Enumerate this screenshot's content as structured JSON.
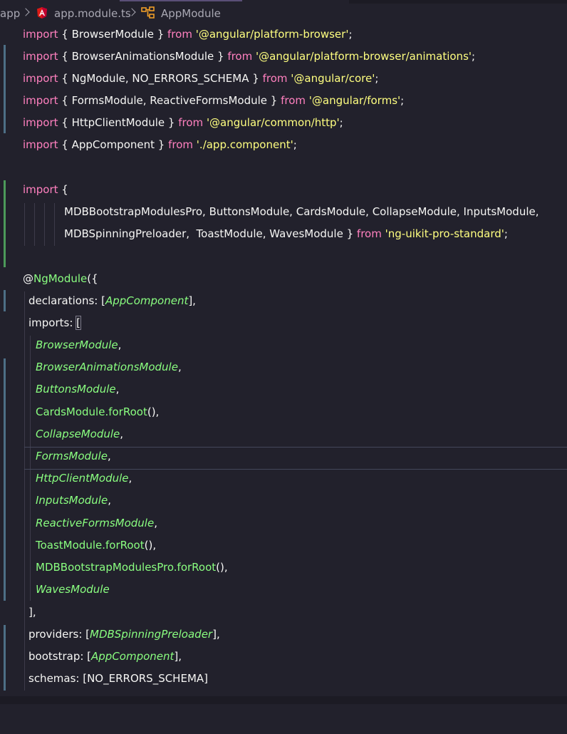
{
  "breadcrumb": {
    "folder": "app",
    "file": "app.module.ts",
    "symbol": "AppModule",
    "file_icon": "angular-icon",
    "symbol_icon": "class-symbol-icon"
  },
  "colors": {
    "background": "#22212c",
    "keyword": "#ff80bf",
    "string": "#ffff80",
    "class": "#8aff80",
    "text": "#f6f6f4",
    "gutter_modified": "#4d6f86",
    "gutter_added": "#4c9a5a"
  },
  "code": {
    "l1": {
      "a": "import",
      "b": " { BrowserModule } ",
      "c": "from",
      "d": " ",
      "e": "'@angular/platform-browser'",
      "f": ";"
    },
    "l2": {
      "a": "import",
      "b": " { BrowserAnimationsModule } ",
      "c": "from",
      "d": " ",
      "e": "'@angular/platform-browser/animations'",
      "f": ";"
    },
    "l3": {
      "a": "import",
      "b": " { NgModule, NO_ERRORS_SCHEMA } ",
      "c": "from",
      "d": " ",
      "e": "'@angular/core'",
      "f": ";"
    },
    "l4": {
      "a": "import",
      "b": " { FormsModule, ReactiveFormsModule } ",
      "c": "from",
      "d": " ",
      "e": "'@angular/forms'",
      "f": ";"
    },
    "l5": {
      "a": "import",
      "b": " { HttpClientModule } ",
      "c": "from",
      "d": " ",
      "e": "'@angular/common/http'",
      "f": ";"
    },
    "l6": {
      "a": "import",
      "b": " { AppComponent } ",
      "c": "from",
      "d": " ",
      "e": "'./app.component'",
      "f": ";"
    },
    "l8": {
      "a": "import",
      "b": " {"
    },
    "l9": {
      "b": "MDBBootstrapModulesPro, ButtonsModule, CardsModule, CollapseModule, InputsModule,"
    },
    "l10": {
      "b": "MDBSpinningPreloader,  ToastModule, WavesModule } ",
      "c": "from",
      "d": " ",
      "e": "'ng-uikit-pro-standard'",
      "f": ";"
    },
    "l12": {
      "a": "@",
      "g": "NgModule",
      "f": "({"
    },
    "l13": {
      "b": "declarations: [",
      "g": "AppComponent",
      "f": "],"
    },
    "l14": {
      "b": "imports: ",
      "f": "["
    },
    "imports": [
      {
        "name": "BrowserModule",
        "suffix": ",",
        "italic": true
      },
      {
        "name": "BrowserAnimationsModule",
        "suffix": ",",
        "italic": true
      },
      {
        "name": "ButtonsModule",
        "suffix": ",",
        "italic": true
      },
      {
        "name": "CardsModule",
        "method": ".forRoot",
        "suffix": "(),",
        "italic": false
      },
      {
        "name": "CollapseModule",
        "suffix": ",",
        "italic": true
      },
      {
        "name": "FormsModule",
        "suffix": ",",
        "italic": true
      },
      {
        "name": "HttpClientModule",
        "suffix": ",",
        "italic": true
      },
      {
        "name": "InputsModule",
        "suffix": ",",
        "italic": true
      },
      {
        "name": "ReactiveFormsModule",
        "suffix": ",",
        "italic": true
      },
      {
        "name": "ToastModule",
        "method": ".forRoot",
        "suffix": "(),",
        "italic": false
      },
      {
        "name": "MDBBootstrapModulesPro",
        "method": ".forRoot",
        "suffix": "(),",
        "italic": false
      },
      {
        "name": "WavesModule",
        "suffix": "",
        "italic": true
      }
    ],
    "l27": {
      "f": "],"
    },
    "l28": {
      "b": "providers: [",
      "g": "MDBSpinningPreloader",
      "f": "],"
    },
    "l29": {
      "b": "bootstrap: [",
      "g": "AppComponent",
      "f": "],"
    },
    "l30": {
      "b": "schemas: [NO_ERRORS_SCHEMA]"
    }
  }
}
